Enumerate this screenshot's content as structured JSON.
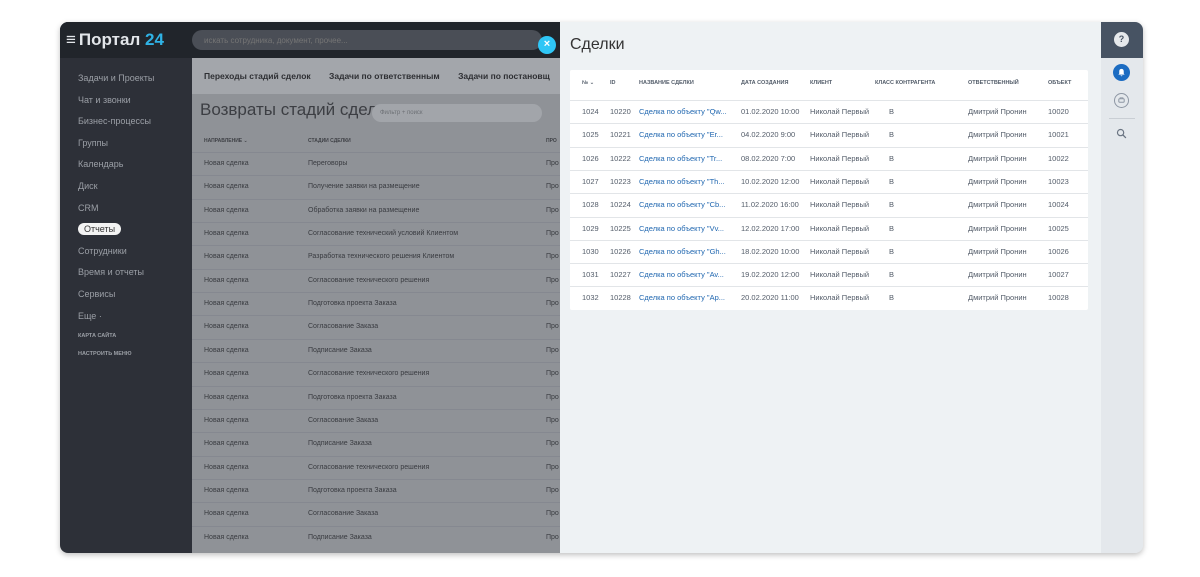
{
  "portal": {
    "burger_glyph": "≡",
    "name": "Портал",
    "number": "24"
  },
  "search": {
    "placeholder": "искать сотрудника, документ, прочее..."
  },
  "sidebar": {
    "items": [
      {
        "label": "Задачи и Проекты"
      },
      {
        "label": "Чат и звонки"
      },
      {
        "label": "Бизнес-процессы"
      },
      {
        "label": "Группы"
      },
      {
        "label": "Календарь"
      },
      {
        "label": "Диск"
      },
      {
        "label": "CRM"
      },
      {
        "label": "Отчеты",
        "active": true
      },
      {
        "label": "Сотрудники"
      },
      {
        "label": "Время и отчеты"
      },
      {
        "label": "Сервисы"
      },
      {
        "label": "Еще ·"
      }
    ],
    "sitemap": "КАРТА САЙТА",
    "customize": "НАСТРОИТЬ МЕНЮ"
  },
  "bg_tabs": [
    "Переходы стадий сделок",
    "Задачи по ответственным",
    "Задачи по постановщ"
  ],
  "bg_report": {
    "title": "Возвраты стадий сделок",
    "filter_placeholder": "Фильтр + поиск",
    "columns": [
      "НАПРАВЛЕНИЕ ⌄",
      "СТАДИИ СДЕЛКИ",
      "ПРО"
    ],
    "rows": [
      [
        "Новая сделка",
        "Переговоры",
        "Про"
      ],
      [
        "Новая сделка",
        "Получение заявки на размещение",
        "Про"
      ],
      [
        "Новая сделка",
        "Обработка заявки на размещение",
        "Про"
      ],
      [
        "Новая сделка",
        "Согласование технический условий Клиентом",
        "Про"
      ],
      [
        "Новая сделка",
        "Разработка технического решения Клиентом",
        "Про"
      ],
      [
        "Новая сделка",
        "Согласование технического решения",
        "Про"
      ],
      [
        "Новая сделка",
        "Подготовка проекта Заказа",
        "Про"
      ],
      [
        "Новая сделка",
        "Согласование Заказа",
        "Про"
      ],
      [
        "Новая сделка",
        "Подписание Заказа",
        "Про"
      ],
      [
        "Новая сделка",
        "Согласование технического решения",
        "Про"
      ],
      [
        "Новая сделка",
        "Подготовка проекта Заказа",
        "Про"
      ],
      [
        "Новая сделка",
        "Согласование Заказа",
        "Про"
      ],
      [
        "Новая сделка",
        "Подписание Заказа",
        "Про"
      ],
      [
        "Новая сделка",
        "Согласование технического решения",
        "Про"
      ],
      [
        "Новая сделка",
        "Подготовка проекта Заказа",
        "Про"
      ],
      [
        "Новая сделка",
        "Согласование Заказа",
        "Про"
      ],
      [
        "Новая сделка",
        "Подписание Заказа",
        "Про"
      ]
    ]
  },
  "close_glyph": "×",
  "slider": {
    "title": "Сделки",
    "columns": [
      "№ ⌄",
      "ID",
      "НАЗВАНИЕ СДЕЛКИ",
      "ДАТА СОЗДАНИЯ",
      "КЛИЕНТ",
      "КЛАСС КОНТРАГЕНТА",
      "ОТВЕТСТВЕННЫЙ",
      "ОБЪЕКТ"
    ],
    "rows": [
      [
        "1024",
        "10220",
        "Сделка по объекту \"Qw...",
        "01.02.2020 10:00",
        "Николай Первый",
        "B",
        "Дмитрий Пронин",
        "10020"
      ],
      [
        "1025",
        "10221",
        "Сделка по объекту \"Er...",
        "04.02.2020 9:00",
        "Николай Первый",
        "B",
        "Дмитрий Пронин",
        "10021"
      ],
      [
        "1026",
        "10222",
        "Сделка по объекту \"Tr...",
        "08.02.2020 7:00",
        "Николай Первый",
        "B",
        "Дмитрий Пронин",
        "10022"
      ],
      [
        "1027",
        "10223",
        "Сделка по объекту \"Th...",
        "10.02.2020 12:00",
        "Николай Первый",
        "B",
        "Дмитрий Пронин",
        "10023"
      ],
      [
        "1028",
        "10224",
        "Сделка по объекту \"Cb...",
        "11.02.2020 16:00",
        "Николай Первый",
        "B",
        "Дмитрий Пронин",
        "10024"
      ],
      [
        "1029",
        "10225",
        "Сделка по объекту \"Vv...",
        "12.02.2020 17:00",
        "Николай Первый",
        "B",
        "Дмитрий Пронин",
        "10025"
      ],
      [
        "1030",
        "10226",
        "Сделка по объекту \"Gh...",
        "18.02.2020 10:00",
        "Николай Первый",
        "B",
        "Дмитрий Пронин",
        "10026"
      ],
      [
        "1031",
        "10227",
        "Сделка по объекту \"Av...",
        "19.02.2020 12:00",
        "Николай Первый",
        "B",
        "Дмитрий Пронин",
        "10027"
      ],
      [
        "1032",
        "10228",
        "Сделка по объекту \"Ap...",
        "20.02.2020 11:00",
        "Николай Первый",
        "B",
        "Дмитрий Пронин",
        "10028"
      ]
    ]
  },
  "rightbar": {
    "help_glyph": "?",
    "icons": [
      "help-icon",
      "bell-icon",
      "chat-icon",
      "search-icon"
    ]
  },
  "colors": {
    "accent": "#2fc6f6",
    "link": "#2067b0",
    "portal_number": "#2fb3e6",
    "notification": "#1c6cc2"
  }
}
